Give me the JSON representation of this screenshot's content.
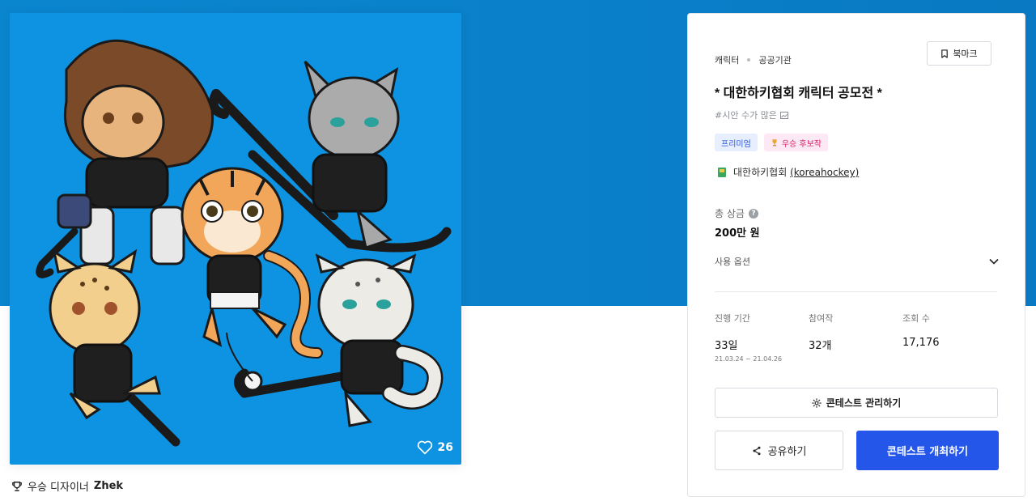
{
  "artwork": {
    "likes": "26",
    "winner_prefix": "우승 디자이너",
    "winner_name": "Zhek"
  },
  "panel": {
    "breadcrumb": [
      "캐릭터",
      "공공기관"
    ],
    "bookmark_label": "북마크",
    "title": "* 대한하키협회 캐릭터 공모전 *",
    "tagline": "#시안 수가 많은",
    "badges": {
      "premium": "프리미엄",
      "winner_candidate": "우승 후보작"
    },
    "host_name": "대한하키협회",
    "host_id": "(koreahockey)",
    "prize_label": "총 상금",
    "prize_value": "200만 원",
    "usage_options_label": "사용 옵션",
    "stats": {
      "period_label": "진행 기간",
      "period_value": "33일",
      "period_dates": "21.03.24 ~ 21.04.26",
      "entries_label": "참여작",
      "entries_value": "32개",
      "views_label": "조회 수",
      "views_value": "17,176"
    },
    "manage_label": "콘테스트 관리하기",
    "share_label": "공유하기",
    "host_contest_label": "콘테스트 개최하기"
  },
  "colors": {
    "hero_blue": "#0a86cf",
    "artwork_blue": "#0d93e2",
    "primary_button": "#2556ea",
    "premium_badge_text": "#2a56d8",
    "winner_badge_text": "#d6236d"
  },
  "icons": [
    "heart-icon",
    "trophy-icon",
    "bookmark-icon",
    "gear-icon",
    "share-icon",
    "chevron-down-icon",
    "question-icon",
    "image-icon"
  ]
}
